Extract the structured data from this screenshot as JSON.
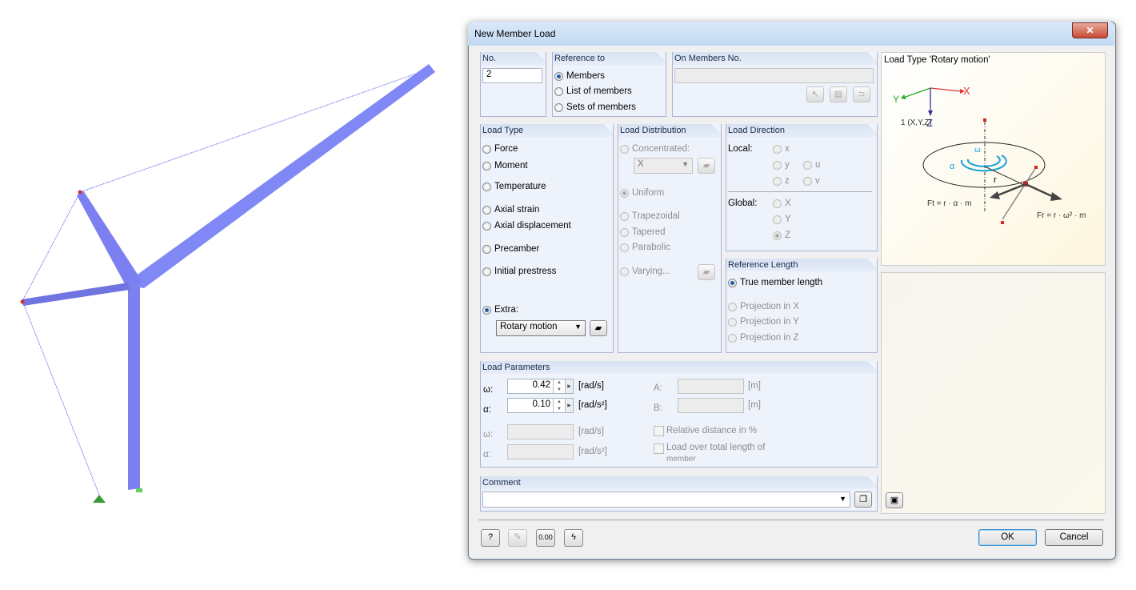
{
  "dialog": {
    "title": "New Member Load",
    "close": "✕"
  },
  "no": {
    "label": "No.",
    "value": "2"
  },
  "reference": {
    "label": "Reference to",
    "options": [
      "Members",
      "List of members",
      "Sets of members"
    ],
    "selected": "Members"
  },
  "on_members": {
    "label": "On Members No.",
    "value": ""
  },
  "load_type": {
    "label": "Load Type",
    "options": [
      "Force",
      "Moment",
      "Temperature",
      "Axial strain",
      "Axial displacement",
      "Precamber",
      "Initial prestress",
      "Extra:"
    ],
    "selected": "Extra:",
    "extra_value": "Rotary motion"
  },
  "load_distribution": {
    "label": "Load Distribution",
    "concentrated": "Concentrated:",
    "concentrated_value": "X",
    "uniform": "Uniform",
    "trapezoidal": "Trapezoidal",
    "tapered": "Tapered",
    "parabolic": "Parabolic",
    "varying": "Varying...",
    "selected": "Uniform"
  },
  "load_direction": {
    "label": "Load Direction",
    "local_label": "Local:",
    "local": [
      "x",
      "y",
      "u",
      "z",
      "v"
    ],
    "global_label": "Global:",
    "global": [
      "X",
      "Y",
      "Z"
    ],
    "selected": "Z"
  },
  "reference_length": {
    "label": "Reference Length",
    "options": [
      "True member length",
      "Projection in X",
      "Projection in Y",
      "Projection in Z"
    ],
    "selected": "True member length"
  },
  "load_parameters": {
    "label": "Load Parameters",
    "omega": {
      "label": "ω:",
      "value": "0.42",
      "unit": "[rad/s]"
    },
    "alpha": {
      "label": "α:",
      "value": "0.10",
      "unit": "[rad/s²]"
    },
    "omega2": {
      "label": "ω:",
      "value": "",
      "unit": "[rad/s]"
    },
    "alpha2": {
      "label": "α:",
      "value": "",
      "unit": "[rad/s²]"
    },
    "A": {
      "label": "A:",
      "value": "",
      "unit": "[m]"
    },
    "B": {
      "label": "B:",
      "value": "",
      "unit": "[m]"
    },
    "relative_distance": "Relative distance in %",
    "load_over_total": "Load over total length of",
    "load_over_total2": "member"
  },
  "comment": {
    "label": "Comment",
    "value": ""
  },
  "preview": {
    "title": "Load Type 'Rotary motion'",
    "axis_x": "X",
    "axis_y": "Y",
    "axis_z": "Z",
    "node": "1 (X,Y,Z)",
    "omega": "ω",
    "alpha": "α",
    "r": "r",
    "ft": "Ft = r · α · m",
    "fr": "Fr = r · ω² · m"
  },
  "buttons": {
    "ok": "OK",
    "cancel": "Cancel"
  },
  "colors": {
    "member": "#7b7ff0",
    "accent": "#1d5fa8",
    "preview_bg": "#fdf9e8"
  }
}
